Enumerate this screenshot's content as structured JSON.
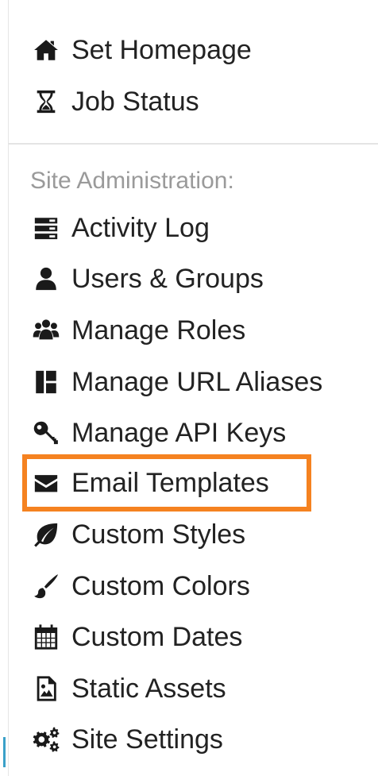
{
  "menu": {
    "top_items": [
      {
        "label": "Set Homepage",
        "icon": "home-icon"
      },
      {
        "label": "Job Status",
        "icon": "hourglass-icon"
      }
    ],
    "section_label": "Site Administration:",
    "admin_items": [
      {
        "label": "Activity Log",
        "icon": "server-icon"
      },
      {
        "label": "Users & Groups",
        "icon": "user-icon"
      },
      {
        "label": "Manage Roles",
        "icon": "users-icon"
      },
      {
        "label": "Manage URL Aliases",
        "icon": "layout-icon"
      },
      {
        "label": "Manage API Keys",
        "icon": "key-icon"
      },
      {
        "label": "Email Templates",
        "icon": "envelope-icon"
      },
      {
        "label": "Custom Styles",
        "icon": "leaf-icon"
      },
      {
        "label": "Custom Colors",
        "icon": "paintbrush-icon"
      },
      {
        "label": "Custom Dates",
        "icon": "calendar-icon"
      },
      {
        "label": "Static Assets",
        "icon": "image-file-icon"
      },
      {
        "label": "Site Settings",
        "icon": "gears-icon"
      }
    ]
  },
  "colors": {
    "highlight_border": "#F58220",
    "section_label": "#9a9a9a",
    "text": "#222222"
  }
}
